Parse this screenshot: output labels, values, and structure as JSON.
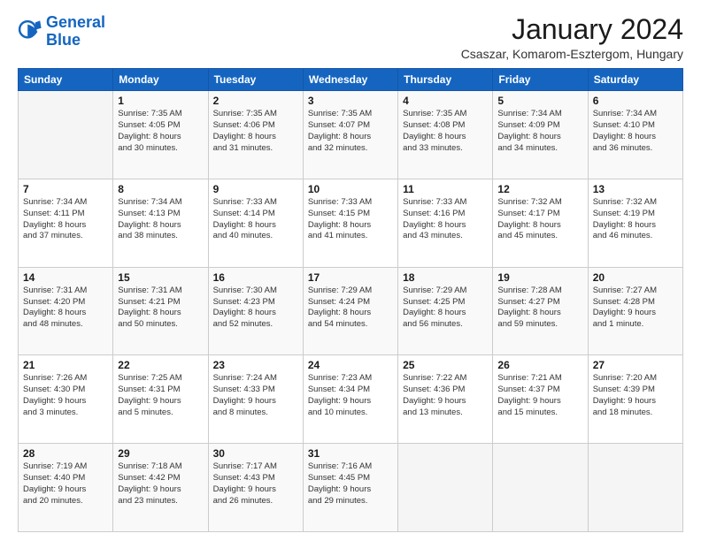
{
  "logo": {
    "line1": "General",
    "line2": "Blue"
  },
  "title": "January 2024",
  "subtitle": "Csaszar, Komarom-Esztergom, Hungary",
  "weekdays": [
    "Sunday",
    "Monday",
    "Tuesday",
    "Wednesday",
    "Thursday",
    "Friday",
    "Saturday"
  ],
  "weeks": [
    [
      {
        "day": "",
        "info": ""
      },
      {
        "day": "1",
        "info": "Sunrise: 7:35 AM\nSunset: 4:05 PM\nDaylight: 8 hours\nand 30 minutes."
      },
      {
        "day": "2",
        "info": "Sunrise: 7:35 AM\nSunset: 4:06 PM\nDaylight: 8 hours\nand 31 minutes."
      },
      {
        "day": "3",
        "info": "Sunrise: 7:35 AM\nSunset: 4:07 PM\nDaylight: 8 hours\nand 32 minutes."
      },
      {
        "day": "4",
        "info": "Sunrise: 7:35 AM\nSunset: 4:08 PM\nDaylight: 8 hours\nand 33 minutes."
      },
      {
        "day": "5",
        "info": "Sunrise: 7:34 AM\nSunset: 4:09 PM\nDaylight: 8 hours\nand 34 minutes."
      },
      {
        "day": "6",
        "info": "Sunrise: 7:34 AM\nSunset: 4:10 PM\nDaylight: 8 hours\nand 36 minutes."
      }
    ],
    [
      {
        "day": "7",
        "info": "Sunrise: 7:34 AM\nSunset: 4:11 PM\nDaylight: 8 hours\nand 37 minutes."
      },
      {
        "day": "8",
        "info": "Sunrise: 7:34 AM\nSunset: 4:13 PM\nDaylight: 8 hours\nand 38 minutes."
      },
      {
        "day": "9",
        "info": "Sunrise: 7:33 AM\nSunset: 4:14 PM\nDaylight: 8 hours\nand 40 minutes."
      },
      {
        "day": "10",
        "info": "Sunrise: 7:33 AM\nSunset: 4:15 PM\nDaylight: 8 hours\nand 41 minutes."
      },
      {
        "day": "11",
        "info": "Sunrise: 7:33 AM\nSunset: 4:16 PM\nDaylight: 8 hours\nand 43 minutes."
      },
      {
        "day": "12",
        "info": "Sunrise: 7:32 AM\nSunset: 4:17 PM\nDaylight: 8 hours\nand 45 minutes."
      },
      {
        "day": "13",
        "info": "Sunrise: 7:32 AM\nSunset: 4:19 PM\nDaylight: 8 hours\nand 46 minutes."
      }
    ],
    [
      {
        "day": "14",
        "info": "Sunrise: 7:31 AM\nSunset: 4:20 PM\nDaylight: 8 hours\nand 48 minutes."
      },
      {
        "day": "15",
        "info": "Sunrise: 7:31 AM\nSunset: 4:21 PM\nDaylight: 8 hours\nand 50 minutes."
      },
      {
        "day": "16",
        "info": "Sunrise: 7:30 AM\nSunset: 4:23 PM\nDaylight: 8 hours\nand 52 minutes."
      },
      {
        "day": "17",
        "info": "Sunrise: 7:29 AM\nSunset: 4:24 PM\nDaylight: 8 hours\nand 54 minutes."
      },
      {
        "day": "18",
        "info": "Sunrise: 7:29 AM\nSunset: 4:25 PM\nDaylight: 8 hours\nand 56 minutes."
      },
      {
        "day": "19",
        "info": "Sunrise: 7:28 AM\nSunset: 4:27 PM\nDaylight: 8 hours\nand 59 minutes."
      },
      {
        "day": "20",
        "info": "Sunrise: 7:27 AM\nSunset: 4:28 PM\nDaylight: 9 hours\nand 1 minute."
      }
    ],
    [
      {
        "day": "21",
        "info": "Sunrise: 7:26 AM\nSunset: 4:30 PM\nDaylight: 9 hours\nand 3 minutes."
      },
      {
        "day": "22",
        "info": "Sunrise: 7:25 AM\nSunset: 4:31 PM\nDaylight: 9 hours\nand 5 minutes."
      },
      {
        "day": "23",
        "info": "Sunrise: 7:24 AM\nSunset: 4:33 PM\nDaylight: 9 hours\nand 8 minutes."
      },
      {
        "day": "24",
        "info": "Sunrise: 7:23 AM\nSunset: 4:34 PM\nDaylight: 9 hours\nand 10 minutes."
      },
      {
        "day": "25",
        "info": "Sunrise: 7:22 AM\nSunset: 4:36 PM\nDaylight: 9 hours\nand 13 minutes."
      },
      {
        "day": "26",
        "info": "Sunrise: 7:21 AM\nSunset: 4:37 PM\nDaylight: 9 hours\nand 15 minutes."
      },
      {
        "day": "27",
        "info": "Sunrise: 7:20 AM\nSunset: 4:39 PM\nDaylight: 9 hours\nand 18 minutes."
      }
    ],
    [
      {
        "day": "28",
        "info": "Sunrise: 7:19 AM\nSunset: 4:40 PM\nDaylight: 9 hours\nand 20 minutes."
      },
      {
        "day": "29",
        "info": "Sunrise: 7:18 AM\nSunset: 4:42 PM\nDaylight: 9 hours\nand 23 minutes."
      },
      {
        "day": "30",
        "info": "Sunrise: 7:17 AM\nSunset: 4:43 PM\nDaylight: 9 hours\nand 26 minutes."
      },
      {
        "day": "31",
        "info": "Sunrise: 7:16 AM\nSunset: 4:45 PM\nDaylight: 9 hours\nand 29 minutes."
      },
      {
        "day": "",
        "info": ""
      },
      {
        "day": "",
        "info": ""
      },
      {
        "day": "",
        "info": ""
      }
    ]
  ]
}
